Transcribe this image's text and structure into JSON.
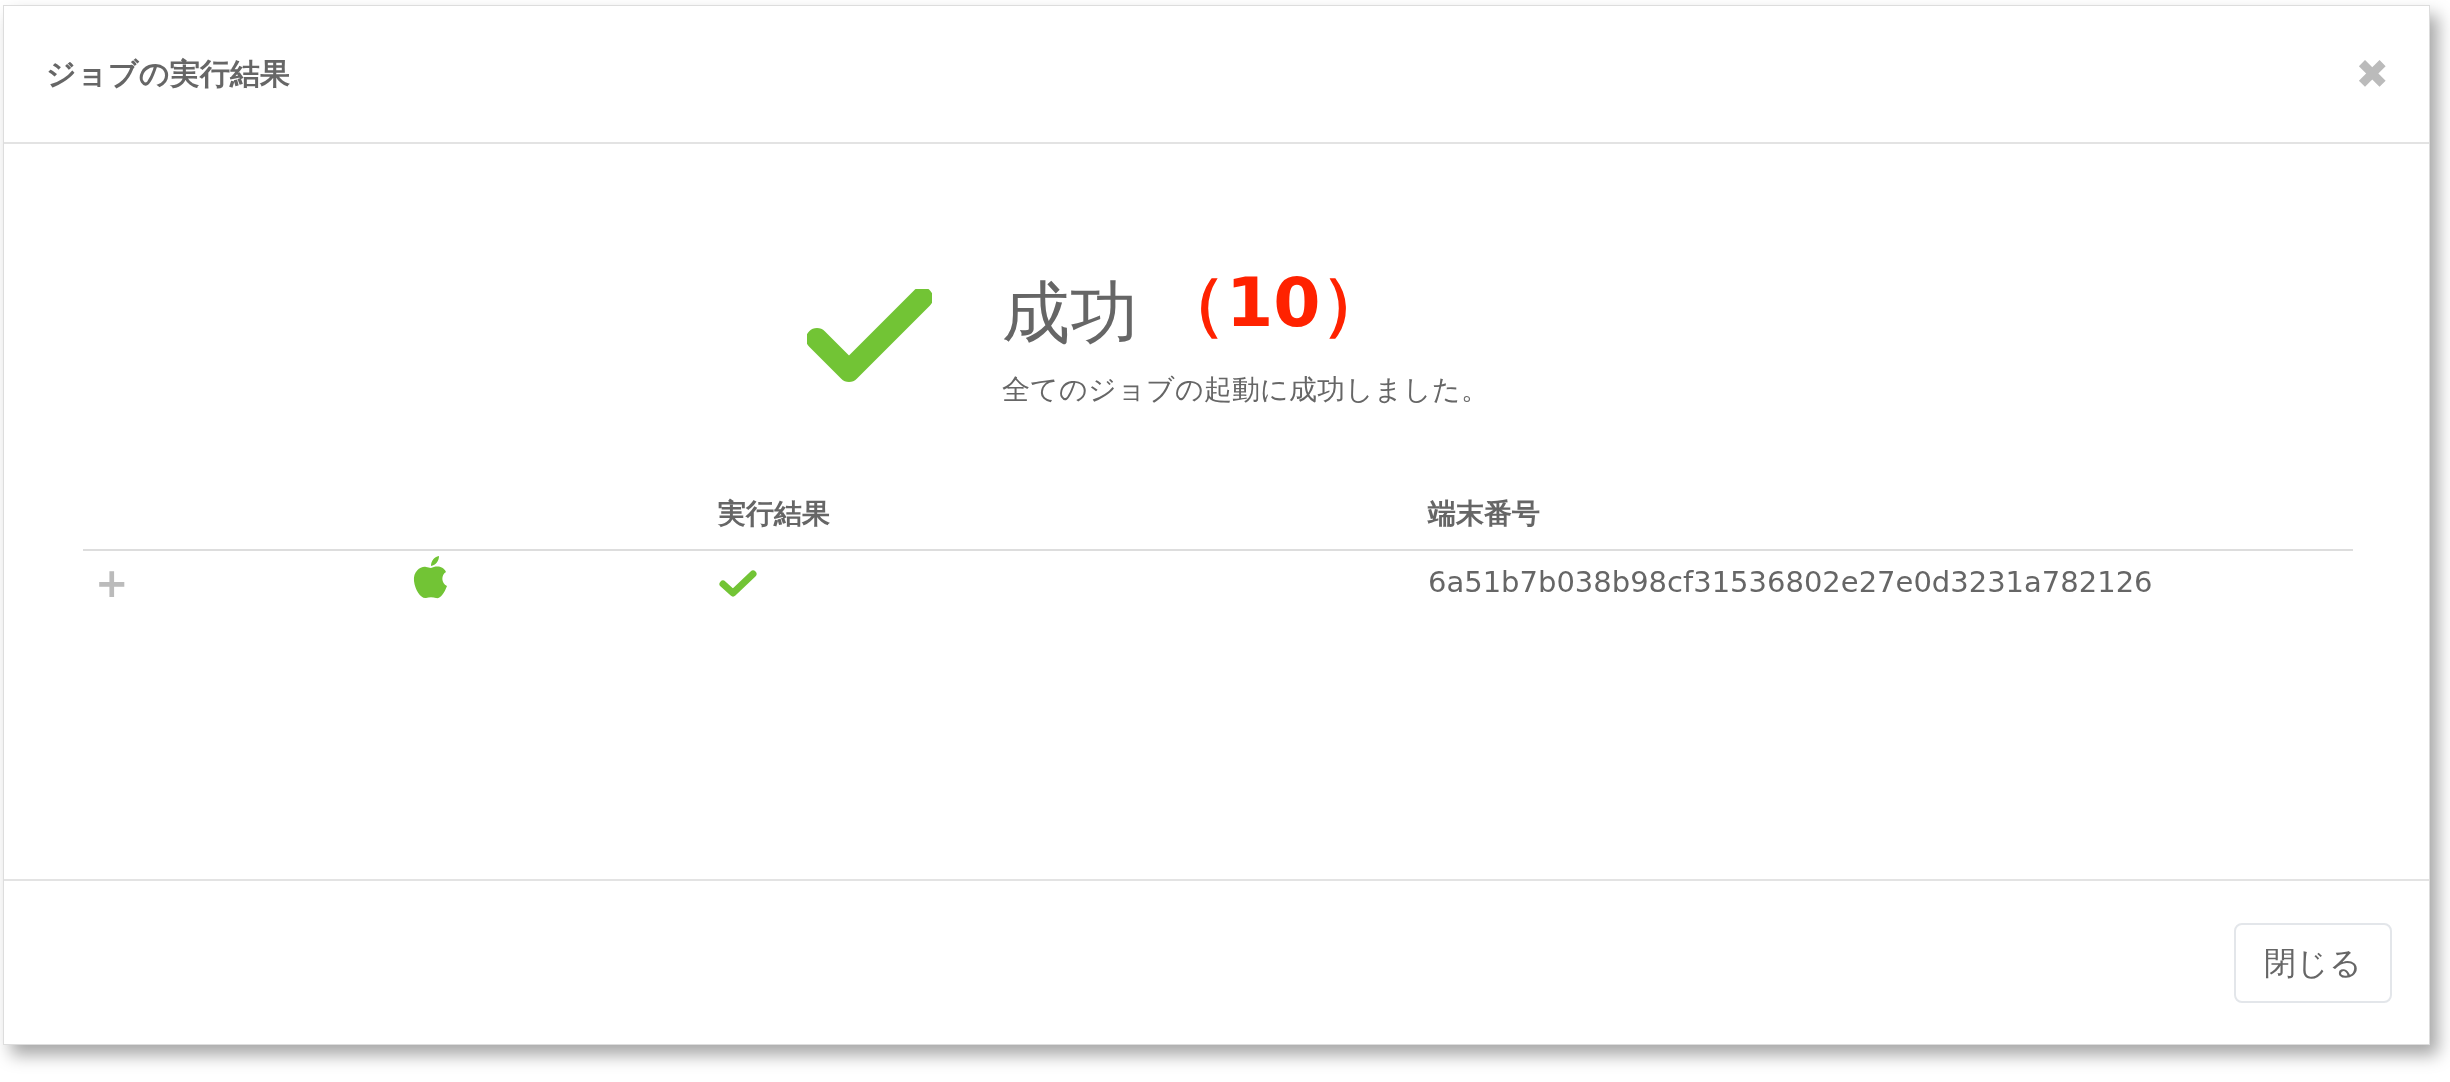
{
  "dialog": {
    "title": "ジョブの実行結果",
    "close_glyph": "✖"
  },
  "summary": {
    "heading": "成功",
    "count": "（10）",
    "message": "全てのジョブの起動に成功しました。"
  },
  "table": {
    "columns": [
      "実行結果",
      "端末番号"
    ],
    "rows": [
      {
        "expand_glyph": "+",
        "success": true,
        "device_id": "6a51b7b038b98cf31536802e27e0d3231a782126"
      }
    ]
  },
  "buttons": [
    {
      "label": "閉じる"
    }
  ]
}
